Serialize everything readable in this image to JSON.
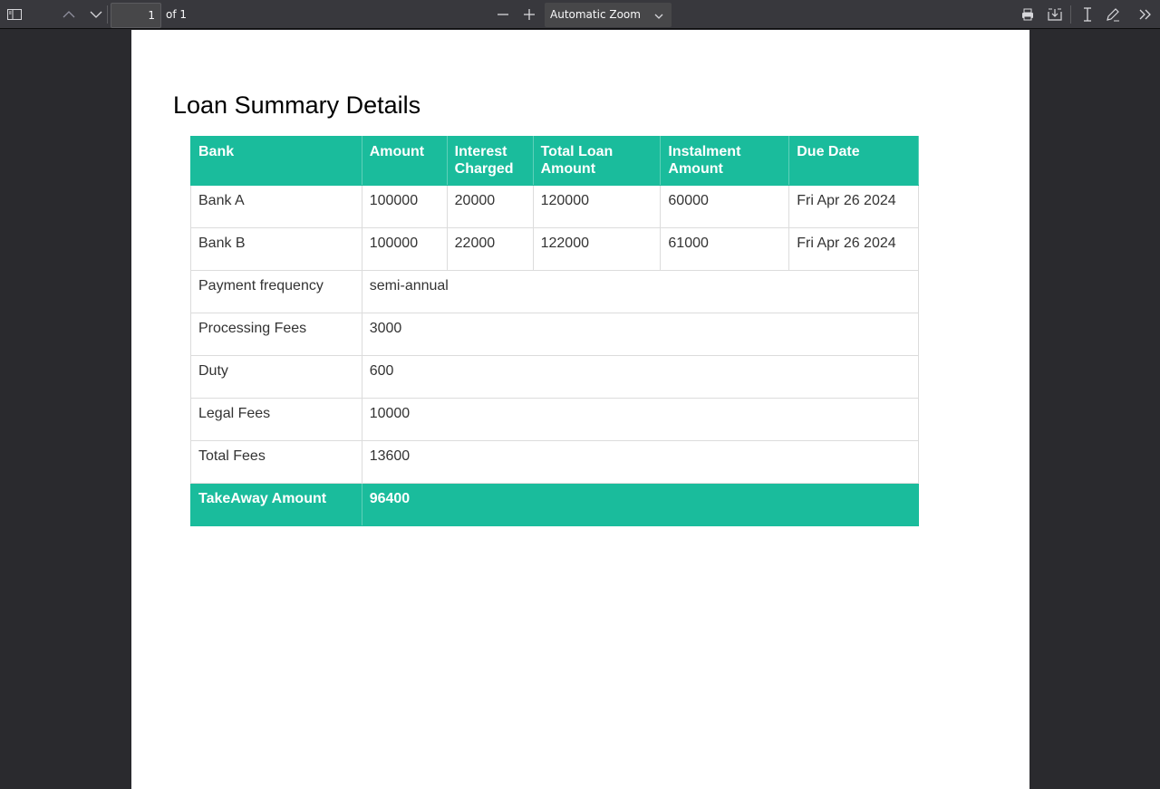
{
  "toolbar": {
    "page_number": "1",
    "page_count": "of 1",
    "zoom": "Automatic Zoom"
  },
  "document": {
    "title": "Loan Summary Details",
    "headers": [
      "Bank",
      "Amount",
      "Interest Charged",
      "Total Loan Amount",
      "Instalment Amount",
      "Due Date"
    ],
    "headers_lines": [
      [
        "Bank"
      ],
      [
        "Amount"
      ],
      [
        "Interest",
        "Charged"
      ],
      [
        "Total Loan",
        "Amount"
      ],
      [
        "Instalment",
        "Amount"
      ],
      [
        "Due Date"
      ]
    ],
    "banks": [
      {
        "bank": "Bank A",
        "amount": "100000",
        "interest": "20000",
        "total": "120000",
        "instalment": "60000",
        "due": "Fri Apr 26 2024"
      },
      {
        "bank": "Bank B",
        "amount": "100000",
        "interest": "22000",
        "total": "122000",
        "instalment": "61000",
        "due": "Fri Apr 26 2024"
      }
    ],
    "details": [
      {
        "label": "Payment frequency",
        "value": "semi-annual"
      },
      {
        "label": "Processing Fees",
        "value": "3000"
      },
      {
        "label": "Duty",
        "value": "600"
      },
      {
        "label": "Legal Fees",
        "value": "10000"
      },
      {
        "label": "Total Fees",
        "value": "13600"
      }
    ],
    "takeaway": {
      "label": "TakeAway Amount",
      "value": "96400"
    }
  },
  "colors": {
    "accent": "#1abc9c",
    "toolbar_bg": "#38383d",
    "viewer_bg": "#2a2a2e"
  }
}
